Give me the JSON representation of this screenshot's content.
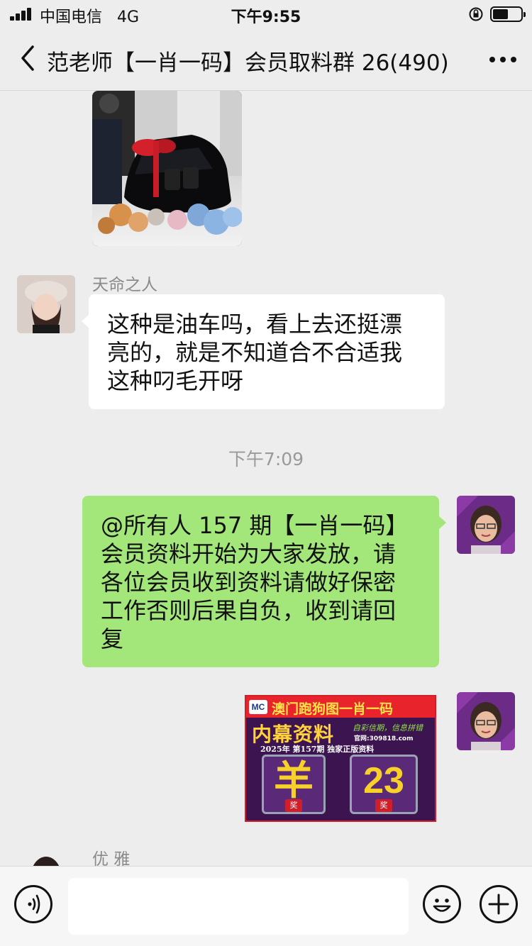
{
  "status_bar": {
    "carrier": "中国电信",
    "network": "4G",
    "time": "下午9:55",
    "battery_level": 0.55
  },
  "nav": {
    "title": "范老师【一肖一码】会员取料群 26(490)",
    "back_icon": "chevron-left-icon",
    "more_icon": "more-dots-icon"
  },
  "messages": [
    {
      "type": "image",
      "side": "left",
      "description_icon": "car-photo"
    },
    {
      "type": "text",
      "side": "left",
      "sender": "天命之人",
      "lines": [
        "这种是油车吗，看上去还挺漂",
        "亮的，就是不知道合不合适我",
        "这种叼毛开呀"
      ]
    },
    {
      "type": "time",
      "text": "下午7:09"
    },
    {
      "type": "text",
      "side": "right",
      "lines": [
        "@所有人 157 期【一肖一码】",
        "会员资料开始为大家发放，请",
        "各位会员收到资料请做好保密",
        "工作否则后果自负，收到请回",
        "复"
      ]
    },
    {
      "type": "image",
      "side": "right",
      "poster": {
        "logo": "MC",
        "headline": "澳门跑狗图一肖一码",
        "sub_headline": "内幕资料",
        "slogan": "自彩信期，信息拼错",
        "site": "官网:309818.com",
        "issue_line": "2025年 第157期 独家正版资料",
        "zodiac": "羊",
        "number": "23",
        "prize_mark": "奖"
      }
    },
    {
      "type": "text",
      "side": "left",
      "sender": "优  雅",
      "lines": []
    }
  ],
  "input_bar": {
    "voice_icon": "voice-icon",
    "emoji_icon": "emoji-icon",
    "plus_icon": "plus-icon"
  },
  "colors": {
    "background": "#ededed",
    "bubble_self": "#a3e67a",
    "bubble_other": "#ffffff",
    "poster_red": "#e8232b",
    "poster_purple": "#4a1a5c",
    "poster_gold": "#f7d02a"
  }
}
